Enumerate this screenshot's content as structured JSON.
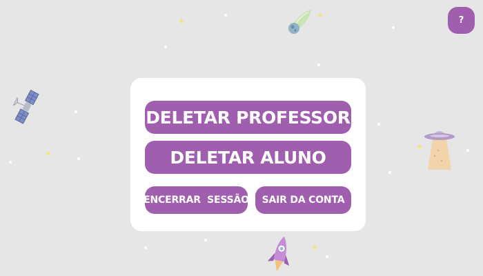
{
  "help_button": {
    "label": "?"
  },
  "menu": {
    "delete_teacher_label": "DELETAR PROFESSOR",
    "delete_student_label": "DELETAR ALUNO",
    "end_session_label": "ENCERRAR  SESSÃO",
    "logout_label": "SAIR DA CONTA"
  },
  "decorations": [
    "satellite-icon",
    "comet-icon",
    "ufo-icon",
    "rocket-icon",
    "star-icon"
  ],
  "colors": {
    "background": "#e6e6e6",
    "panel": "#ffffff",
    "accent": "#a05eaf",
    "button_text": "#ffffff"
  }
}
